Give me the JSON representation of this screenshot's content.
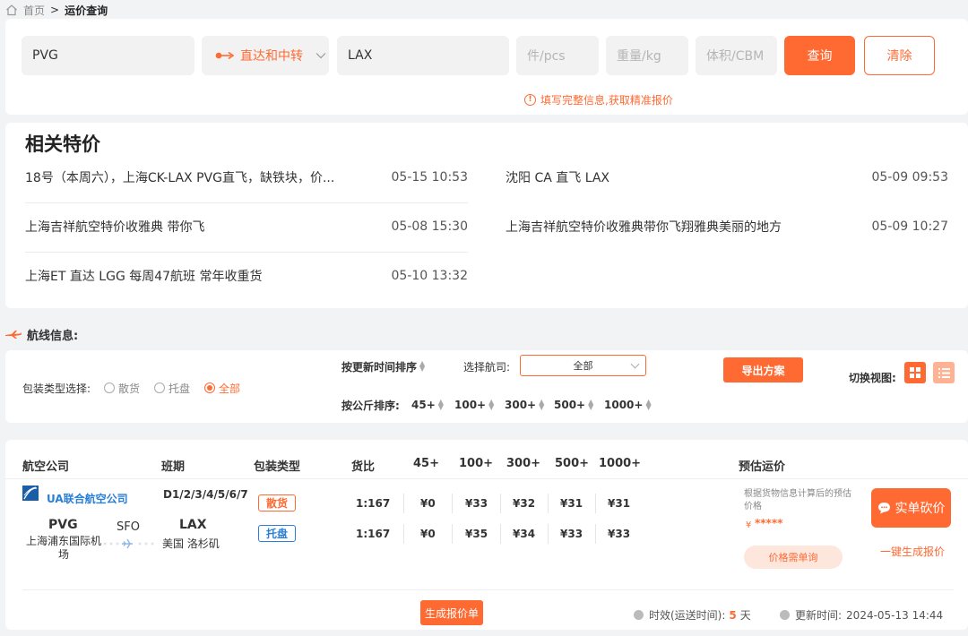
{
  "breadcrumb": {
    "home": "首页",
    "separator": ">",
    "current": "运价查询"
  },
  "search": {
    "origin": "PVG",
    "route_type": "直达和中转",
    "destination": "LAX",
    "pcs_placeholder": "件/pcs",
    "weight_placeholder": "重量/kg",
    "volume_placeholder": "体积/CBM",
    "query_label": "查询",
    "clear_label": "清除",
    "hint": "填写完整信息,获取精准报价"
  },
  "specials": {
    "title": "相关特价",
    "items": [
      {
        "text": "18号（本周六），上海CK-LAX PVG直飞，缺铁块，价...",
        "date": "05-15 10:53"
      },
      {
        "text": "沈阳 CA 直飞 LAX",
        "date": "05-09 09:53"
      },
      {
        "text": "上海吉祥航空特价收雅典 带你飞",
        "date": "05-08 15:30"
      },
      {
        "text": "上海吉祥航空特价收雅典带你飞翔雅典美丽的地方",
        "date": "05-09 10:27"
      },
      {
        "text": "上海ET 直达 LGG 每周47航班 常年收重货",
        "date": "05-10 13:32"
      }
    ]
  },
  "route_info": {
    "label": "航线信息:",
    "package_type_label": "包装类型选择:",
    "package_options": [
      "散货",
      "托盘",
      "全部"
    ],
    "package_selected": "全部",
    "sort_by_update": "按更新时间排序",
    "airline_label": "选择航司:",
    "airline_value": "全部",
    "export_label": "导出方案",
    "switch_view_label": "切换视图:",
    "sort_by_kg_label": "按公斤排序:",
    "kg_sorts": [
      "45+",
      "100+",
      "300+",
      "500+",
      "1000+"
    ]
  },
  "results": {
    "headers": {
      "airline": "航空公司",
      "schedule": "班期",
      "package": "包装类型",
      "ratio": "货比",
      "w45": "45+",
      "w100": "100+",
      "w300": "300+",
      "w500": "500+",
      "w1000": "1000+",
      "estimate": "预估运价"
    },
    "airline_name": "UA联合航空公司",
    "schedule": "D1/2/3/4/5/6/7",
    "origin_code": "PVG",
    "origin_name": "上海浦东国际机场",
    "transit_code": "SFO",
    "dest_code": "LAX",
    "dest_name": "美国 洛杉矶",
    "rows": [
      {
        "tag": "散货",
        "ratio": "1:167",
        "p45": "¥0",
        "p100": "¥33",
        "p300": "¥32",
        "p500": "¥31",
        "p1000": "¥31"
      },
      {
        "tag": "托盘",
        "ratio": "1:167",
        "p45": "¥0",
        "p100": "¥35",
        "p300": "¥34",
        "p500": "¥33",
        "p1000": "¥33"
      }
    ],
    "estimate_note": "根据货物信息计算后的预估价格",
    "estimate_currency": "¥",
    "estimate_masked": "*****",
    "price_pill": "价格需单询",
    "bargain_label": "实单砍价",
    "one_click_quote": "一键生成报价",
    "generate_quote": "生成报价单",
    "transit_time_label": "时效(运送时间):",
    "transit_time_value": "5",
    "transit_time_unit": "天",
    "update_label": "更新时间:",
    "update_value": "2024-05-13 14:44"
  },
  "colors": {
    "accent": "#ff6a33",
    "blue": "#2a7fd6",
    "airline_blue": "#1a5ea8"
  }
}
